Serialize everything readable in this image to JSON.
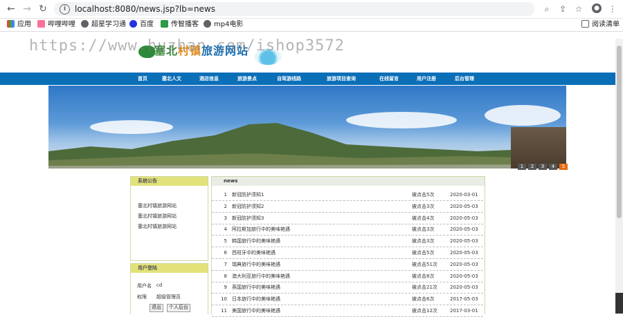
{
  "browser": {
    "url": "localhost:8080/news.jsp?lb=news",
    "bookmarks": [
      "应用",
      "哔哩哔哩",
      "超星学习通",
      "百度",
      "传智播客",
      "mp4电影"
    ],
    "reading_list": "阅读清单"
  },
  "site": {
    "title_part1": "塞北",
    "title_part2": "村镇",
    "title_part3": "旅游网站",
    "watermark": "https://www.huzhan.com/ishop3572"
  },
  "nav": [
    "首页",
    "塞北人文",
    "酒店信息",
    "旅游景点",
    "自驾游线路",
    "旅游项目查询",
    "在线留言",
    "用户注册",
    "后台管理"
  ],
  "banner": {
    "pages": [
      "1",
      "2",
      "3",
      "4",
      "5"
    ],
    "active_page": "5"
  },
  "notice_panel": {
    "title": "系统公告",
    "items": [
      "塞北村镇旅游网站",
      "塞北村镇旅游网站",
      "塞北村镇旅游网站"
    ]
  },
  "login_panel": {
    "title": "用户登陆",
    "username_label": "用户名",
    "username_value": "cd",
    "role_label": "权限",
    "role_value": "超级管理员",
    "logout_btn": "退出",
    "backend_btn": "个人后台"
  },
  "news_panel": {
    "title": "news",
    "rows": [
      {
        "idx": "1",
        "title": "新冠防护须知1",
        "views": "被点击5次",
        "date": "2020-03-01"
      },
      {
        "idx": "2",
        "title": "新冠防护须知2",
        "views": "被点击3次",
        "date": "2020-05-03"
      },
      {
        "idx": "3",
        "title": "新冠防护须知3",
        "views": "被点击4次",
        "date": "2020-05-03"
      },
      {
        "idx": "4",
        "title": "阿拉斯加旅行中的美味艳遇",
        "views": "被点击3次",
        "date": "2020-05-03"
      },
      {
        "idx": "5",
        "title": "韩国旅行中的美味艳遇",
        "views": "被点击3次",
        "date": "2020-05-03"
      },
      {
        "idx": "6",
        "title": "西班牙中的美味艳遇",
        "views": "被点击5次",
        "date": "2020-05-03"
      },
      {
        "idx": "7",
        "title": "瑞典旅行中的美味艳遇",
        "views": "被点击51次",
        "date": "2020-05-03"
      },
      {
        "idx": "8",
        "title": "澳大利亚旅行中的美味艳遇",
        "views": "被点击8次",
        "date": "2020-05-03"
      },
      {
        "idx": "9",
        "title": "英国旅行中的美味艳遇",
        "views": "被点击21次",
        "date": "2020-05-03"
      },
      {
        "idx": "10",
        "title": "日本旅行中的美味艳遇",
        "views": "被点击6次",
        "date": "2017-05-03"
      },
      {
        "idx": "11",
        "title": "美国旅行中的美味艳遇",
        "views": "被点击12次",
        "date": "2017-03-01"
      }
    ]
  },
  "colors": {
    "nav_bg": "#0b6fb8",
    "panel_head": "#e2e27a",
    "active_page": "#e56b12"
  }
}
